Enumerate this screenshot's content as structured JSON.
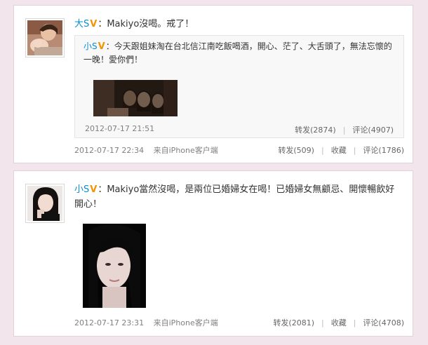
{
  "posts": [
    {
      "author": "大S",
      "verified_badge": "V",
      "text": "：Makiyo沒喝。戒了！",
      "repost": {
        "author": "小S",
        "verified_badge": "V",
        "text": "：今天跟姐妹淘在台北信江南吃飯喝酒，開心、茫了、大舌頭了，無法忘懷的一晚！愛你們！",
        "timestamp": "2012-07-17 21:51",
        "repost_label": "转发(2874)",
        "comment_label": "评论(4907)"
      },
      "timestamp": "2012-07-17 22:34",
      "source": "来自iPhone客户端",
      "repost_label": "转发(509)",
      "favorite_label": "收藏",
      "comment_label": "评论(1786)"
    },
    {
      "author": "小S",
      "verified_badge": "V",
      "text": "：Makiyo當然沒喝，是兩位已婚婦女在喝！已婚婦女無顧忌、開懷暢飲好開心！",
      "timestamp": "2012-07-17 23:31",
      "source": "来自iPhone客户端",
      "repost_label": "转发(2081)",
      "favorite_label": "收藏",
      "comment_label": "评论(4708)"
    }
  ],
  "colors": {
    "username": "#0a8cd2",
    "verified": "#f29400",
    "page_background": "#f2e6ec"
  }
}
